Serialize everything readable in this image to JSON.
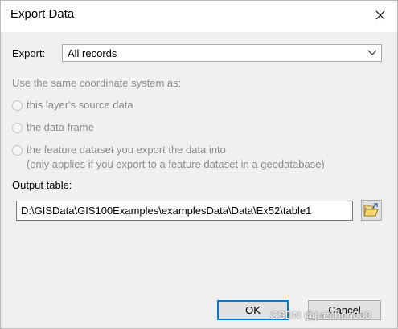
{
  "window": {
    "title": "Export Data",
    "close_icon": "close-icon"
  },
  "export": {
    "label": "Export:",
    "selected": "All records",
    "arrow_icon": "chevron-down-icon"
  },
  "coordinate": {
    "heading": "Use the same coordinate system as:",
    "options": [
      {
        "line1": "this layer's source data",
        "line2": "",
        "enabled": false,
        "checked": false
      },
      {
        "line1": "the data frame",
        "line2": "",
        "enabled": false,
        "checked": false
      },
      {
        "line1": "the feature dataset you export the data into",
        "line2": "(only applies if you export to a feature dataset in a geodatabase)",
        "enabled": false,
        "checked": false
      }
    ]
  },
  "output": {
    "label": "Output table:",
    "value": "D:\\GISData\\GIS100Examples\\examplesData\\Data\\Ex52\\table1",
    "browse_icon": "folder-browse-icon"
  },
  "buttons": {
    "ok": "OK",
    "cancel": "Cancel"
  },
  "watermark": "CSDN @juechen333"
}
